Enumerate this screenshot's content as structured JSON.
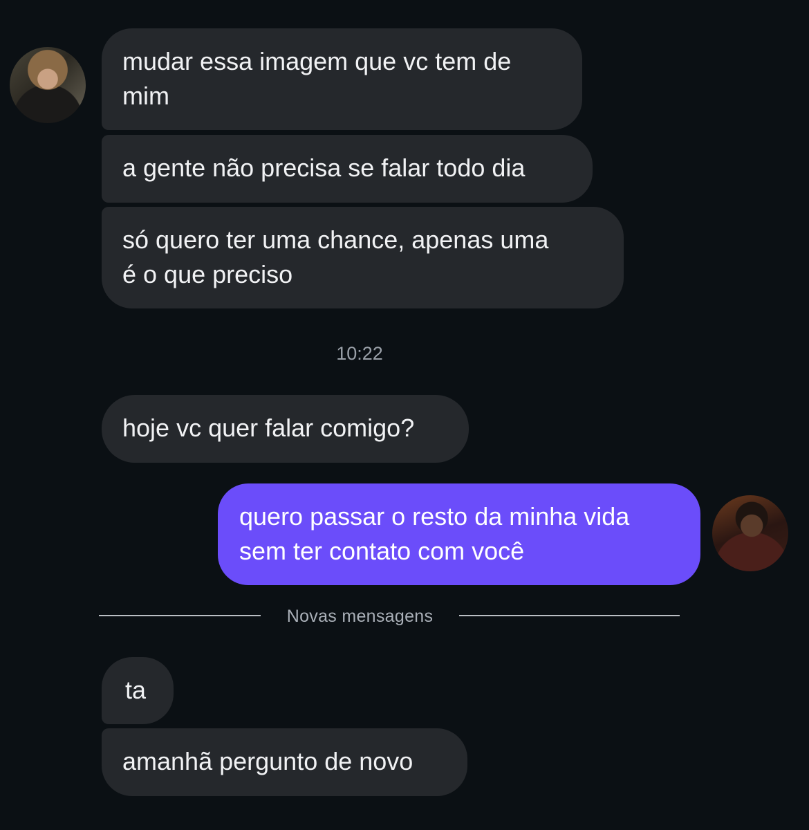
{
  "conversation": {
    "incoming_avatar": "contact-avatar-photo",
    "outgoing_avatar": "user-avatar-photo",
    "messages_before": [
      {
        "lines": [
          "mudar essa imagem que vc tem de",
          "mim"
        ]
      },
      {
        "lines": [
          "a gente não precisa se falar todo dia"
        ]
      },
      {
        "lines": [
          "só quero ter uma chance, apenas uma",
          "é o que preciso"
        ]
      }
    ],
    "timestamp": "10:22",
    "messages_after": [
      {
        "lines": [
          "hoje vc quer falar comigo?"
        ]
      }
    ],
    "sent": {
      "lines": [
        "quero passar o resto da minha vida",
        "sem ter contato com você"
      ]
    },
    "new_messages_divider": "Novas mensagens",
    "new_messages": [
      {
        "lines": [
          "ta"
        ]
      },
      {
        "lines": [
          "amanhã pergunto de novo"
        ]
      }
    ]
  },
  "colors": {
    "background": "#0b1014",
    "incoming_bubble": "#25282c",
    "outgoing_bubble": "#6b4dfa",
    "timestamp_text": "#9aa0a8"
  }
}
